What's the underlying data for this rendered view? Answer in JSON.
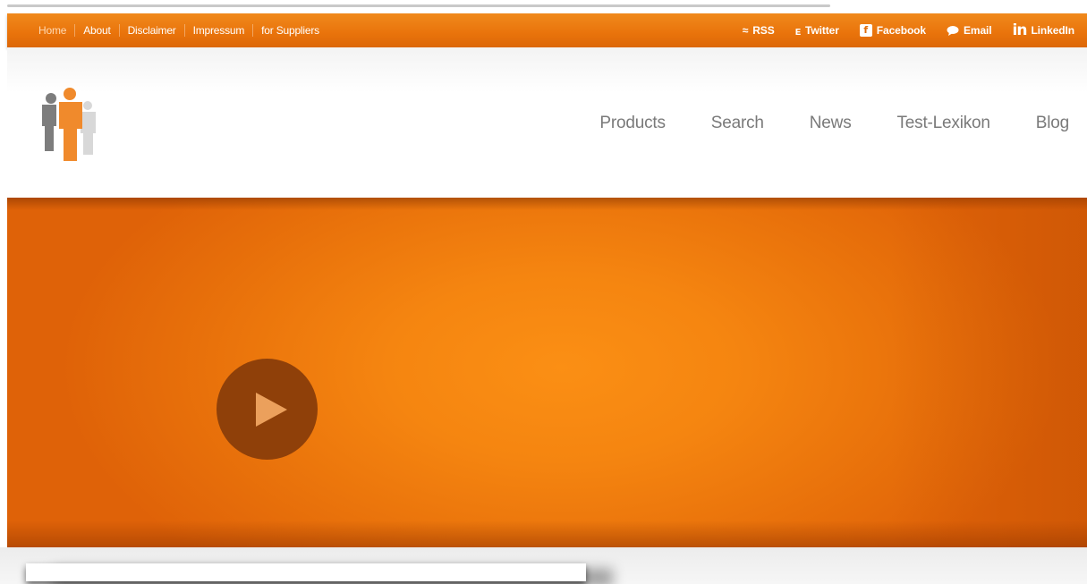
{
  "top_nav": {
    "links": [
      {
        "label": "Home"
      },
      {
        "label": "About"
      },
      {
        "label": "Disclaimer"
      },
      {
        "label": "Impressum"
      },
      {
        "label": "for Suppliers"
      }
    ],
    "social": [
      {
        "label": "RSS",
        "icon": "rss-icon"
      },
      {
        "label": "Twitter",
        "icon": "twitter-icon"
      },
      {
        "label": "Facebook",
        "icon": "facebook-icon"
      },
      {
        "label": "Email",
        "icon": "speech-bubble-icon"
      },
      {
        "label": "LinkedIn",
        "icon": "linkedin-icon"
      }
    ]
  },
  "header": {
    "logo": "people-group-logo",
    "main_nav": [
      "Products",
      "Search",
      "News",
      "Test-Lexikon",
      "Blog"
    ]
  },
  "hero": {
    "play_icon": "play-icon"
  },
  "colors": {
    "accent_orange": "#f08a1c",
    "hero_center": "#fb8f14",
    "play_button": "#8f4009",
    "nav_text": "#7a7a7a"
  }
}
